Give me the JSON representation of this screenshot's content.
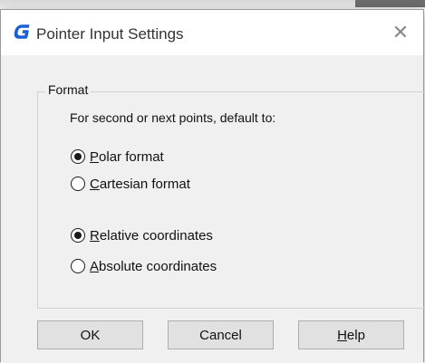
{
  "dialog": {
    "title": "Pointer Input Settings",
    "close_glyph": "✕"
  },
  "format_group": {
    "legend": "Format",
    "prompt": "For second or next points, default to:",
    "format_options": [
      {
        "mnemonic": "P",
        "rest": "olar format",
        "selected": true
      },
      {
        "mnemonic": "C",
        "rest": "artesian format",
        "selected": false
      }
    ],
    "coordinate_options": [
      {
        "mnemonic": "R",
        "rest": "elative coordinates",
        "selected": true
      },
      {
        "mnemonic": "A",
        "rest": "bsolute coordinates",
        "selected": false
      }
    ]
  },
  "buttons": {
    "ok": "OK",
    "cancel": "Cancel",
    "help_mnemonic": "H",
    "help_rest": "elp"
  },
  "colors": {
    "app_icon": "#1a5fd6",
    "dialog_bg": "#f0f0f0",
    "button_bg": "#e1e1e1"
  },
  "icons": {
    "app": "app-logo-icon",
    "close": "close-icon"
  }
}
